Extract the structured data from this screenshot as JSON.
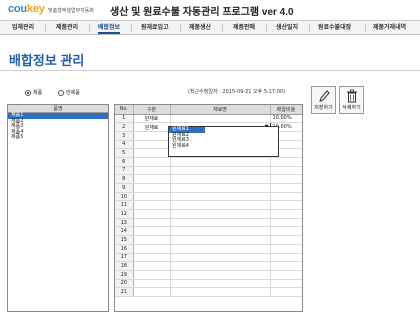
{
  "header": {
    "logo_main": "cou",
    "logo_accent": "key",
    "logo_sub": "맞춤형엑셀업무자동화",
    "app_title": "생산 및 원료수불 자동관리 프로그램 ver 4.0"
  },
  "menu": {
    "items": [
      {
        "label": "업체관리",
        "active": false
      },
      {
        "label": "제품관리",
        "active": false
      },
      {
        "label": "배합정보",
        "active": true
      },
      {
        "label": "원재료입고",
        "active": false
      },
      {
        "label": "제품생산",
        "active": false
      },
      {
        "label": "제품판매",
        "active": false
      },
      {
        "label": "생산일지",
        "active": false
      },
      {
        "label": "원료수불대장",
        "active": false
      },
      {
        "label": "제품거래내역",
        "active": false
      }
    ]
  },
  "page": {
    "title": "배합정보 관리",
    "radio_product": "제품",
    "radio_semi": "반제품",
    "selected_radio": "product",
    "modified_label": "(최근수정일자 : 2015-09-21 오후 5:17:00)"
  },
  "toolbar": {
    "save_label": "저장하기",
    "delete_label": "삭제하기"
  },
  "product_list": {
    "header": "품명",
    "items": [
      "제품1",
      "제품2",
      "제품3",
      "제품4",
      "제품5"
    ],
    "selected_index": 0
  },
  "grid": {
    "columns": [
      "No.",
      "구분",
      "재료명",
      "배합비율"
    ],
    "rows": [
      {
        "no": "1",
        "kind": "원재료",
        "material": "",
        "ratio": "10.00%"
      },
      {
        "no": "2",
        "kind": "원재료",
        "material": "",
        "ratio": "10.00%"
      },
      {
        "no": "3",
        "kind": "",
        "material": "",
        "ratio": ""
      },
      {
        "no": "4",
        "kind": "",
        "material": "",
        "ratio": ""
      },
      {
        "no": "5",
        "kind": "",
        "material": "",
        "ratio": ""
      },
      {
        "no": "6",
        "kind": "",
        "material": "",
        "ratio": ""
      },
      {
        "no": "7",
        "kind": "",
        "material": "",
        "ratio": ""
      },
      {
        "no": "8",
        "kind": "",
        "material": "",
        "ratio": ""
      },
      {
        "no": "9",
        "kind": "",
        "material": "",
        "ratio": ""
      },
      {
        "no": "10",
        "kind": "",
        "material": "",
        "ratio": ""
      },
      {
        "no": "11",
        "kind": "",
        "material": "",
        "ratio": ""
      },
      {
        "no": "12",
        "kind": "",
        "material": "",
        "ratio": ""
      },
      {
        "no": "13",
        "kind": "",
        "material": "",
        "ratio": ""
      },
      {
        "no": "14",
        "kind": "",
        "material": "",
        "ratio": ""
      },
      {
        "no": "15",
        "kind": "",
        "material": "",
        "ratio": ""
      },
      {
        "no": "16",
        "kind": "",
        "material": "",
        "ratio": ""
      },
      {
        "no": "17",
        "kind": "",
        "material": "",
        "ratio": ""
      },
      {
        "no": "18",
        "kind": "",
        "material": "",
        "ratio": ""
      },
      {
        "no": "19",
        "kind": "",
        "material": "",
        "ratio": ""
      },
      {
        "no": "20",
        "kind": "",
        "material": "",
        "ratio": ""
      },
      {
        "no": "21",
        "kind": "",
        "material": "",
        "ratio": ""
      }
    ]
  },
  "dropdown": {
    "options": [
      "원재료1",
      "원재료2",
      "원재료3",
      "원재료4"
    ],
    "selected_index": 0
  },
  "colors": {
    "accent": "#1f5ea8",
    "selection": "#2f6fc0",
    "logo_blue": "#2e86c8",
    "logo_orange": "#f3a21b"
  }
}
